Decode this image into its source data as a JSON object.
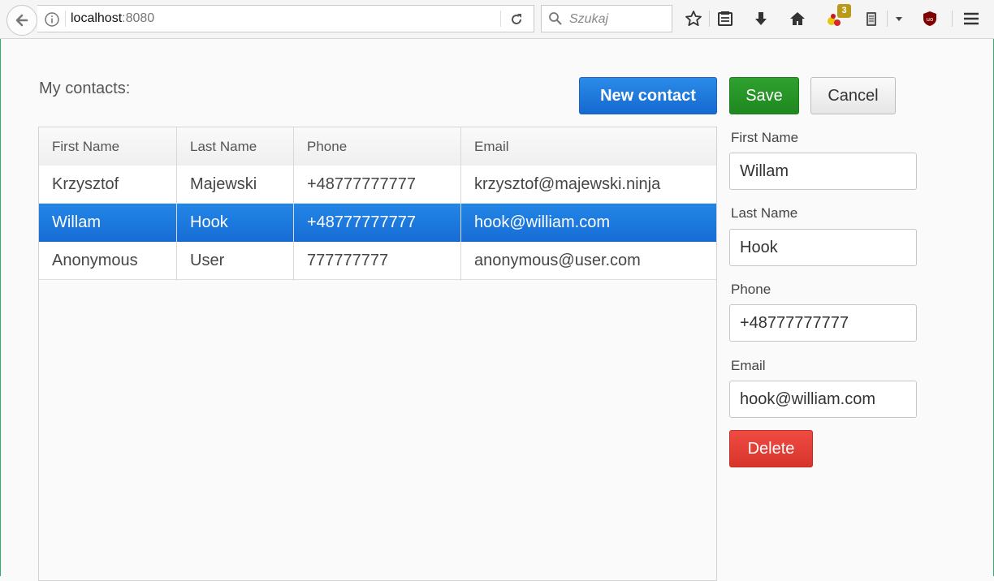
{
  "browser": {
    "url_host": "localhost",
    "url_port": ":8080",
    "search_placeholder": "Szukaj",
    "addon_badge": "3"
  },
  "page": {
    "heading": "My contacts:",
    "buttons": {
      "new_contact": "New contact",
      "save": "Save",
      "cancel": "Cancel",
      "delete": "Delete"
    }
  },
  "table": {
    "columns": [
      "First Name",
      "Last Name",
      "Phone",
      "Email"
    ],
    "rows": [
      [
        "Krzysztof",
        "Majewski",
        "+48777777777",
        "krzysztof@majewski.ninja"
      ],
      [
        "Willam",
        "Hook",
        "+48777777777",
        "hook@william.com"
      ],
      [
        "Anonymous",
        "User",
        "777777777",
        "anonymous@user.com"
      ]
    ],
    "selected_row_index": 1
  },
  "form": {
    "first_name": {
      "label": "First Name",
      "value": "Willam"
    },
    "last_name": {
      "label": "Last Name",
      "value": "Hook"
    },
    "phone": {
      "label": "Phone",
      "value": "+48777777777"
    },
    "email": {
      "label": "Email",
      "value": "hook@william.com"
    }
  },
  "colors": {
    "primary": "#1a75dc",
    "success": "#24922b",
    "danger": "#e03d34",
    "selection": "#1d79df"
  }
}
